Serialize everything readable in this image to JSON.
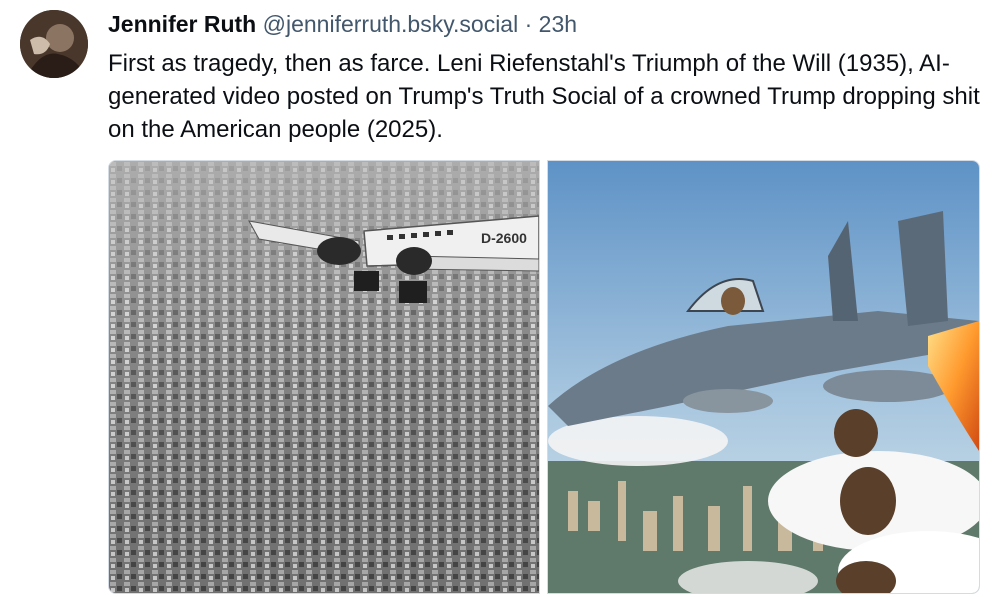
{
  "post": {
    "author_name": "Jennifer Ruth",
    "handle": "@jenniferruth.bsky.social",
    "separator": "·",
    "timestamp": "23h",
    "text": "First as tragedy, then as farce. Leni Riefenstahl's Triumph of the Will (1935), AI-generated video posted on Trump's Truth Social of a crowned Trump dropping shit on the American people (2025)."
  },
  "media": {
    "left_plane_marking": "D-2600"
  },
  "colors": {
    "text": "#0b0f14",
    "muted": "#42576c",
    "border": "#d4dbe2"
  }
}
